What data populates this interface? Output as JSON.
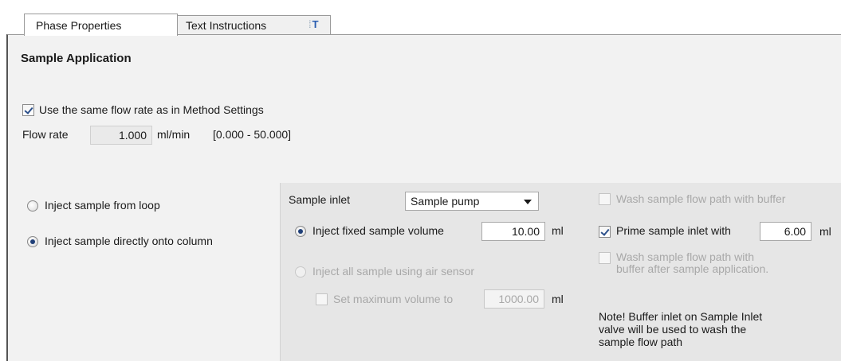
{
  "tabs": {
    "phase_properties": "Phase Properties",
    "text_instructions": "Text Instructions",
    "text_instructions_icon": "T"
  },
  "section": {
    "title": "Sample Application"
  },
  "flow": {
    "same_flow_rate_label": "Use the same flow rate as in Method Settings",
    "same_flow_rate_checked": true,
    "flow_rate_label": "Flow rate",
    "flow_rate_value": "1.000",
    "flow_rate_unit": "ml/min",
    "flow_rate_range": "[0.000 - 50.000]"
  },
  "injection_mode": {
    "from_loop": "Inject sample from loop",
    "directly": "Inject sample directly onto column",
    "selected": "directly"
  },
  "sample": {
    "inlet_label": "Sample inlet",
    "inlet_value": "Sample pump",
    "fixed_volume_label": "Inject fixed sample volume",
    "fixed_volume_value": "10.00",
    "fixed_volume_unit": "ml",
    "air_sensor_label": "Inject all sample using air sensor",
    "max_volume_label": "Set maximum volume to",
    "max_volume_value": "1000.00",
    "max_volume_unit": "ml"
  },
  "wash": {
    "wash_before_label": "Wash sample flow path with buffer",
    "prime_label": "Prime sample inlet with",
    "prime_value": "6.00",
    "prime_unit": "ml",
    "wash_after_line1": "Wash sample flow path with",
    "wash_after_line2": "buffer after sample application.",
    "note_line1": "Note! Buffer inlet on Sample Inlet",
    "note_line2": "valve will be used to wash the",
    "note_line3": "sample flow path"
  },
  "colors": {
    "panel_bg": "#f2f2f2",
    "subpanel_bg": "#e6e6e6",
    "disabled_text": "#a8a8a8",
    "accent": "#2a5db0"
  }
}
